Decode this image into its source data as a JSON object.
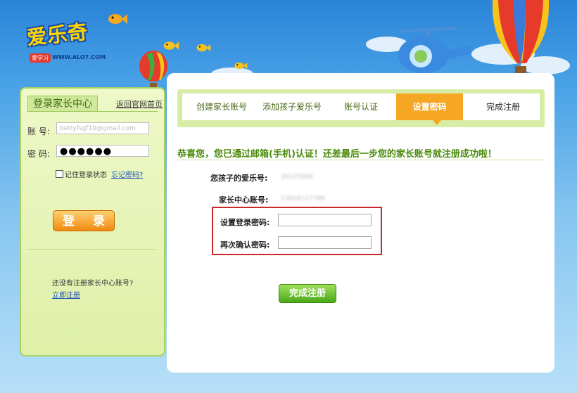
{
  "logo": {
    "name": "爱乐奇",
    "badge": "爱学习",
    "url": "WWW.ALO7.COM"
  },
  "sidebar": {
    "tab_title": "登录家长中心",
    "back_link": "返回官网首页",
    "account_label": "账 号:",
    "account_value": "bettyfsgf10@gmail.com",
    "password_label": "密 码:",
    "password_value": "●●●●●●",
    "remember_label": "记住登录状态",
    "forgot_link": "忘记密码?",
    "login_button": "登 录",
    "no_account_text": "还没有注册家长中心账号?",
    "register_link": "立即注册"
  },
  "steps": [
    {
      "label": "创建家长账号",
      "active": false
    },
    {
      "label": "添加孩子爱乐号",
      "active": false
    },
    {
      "label": "账号认证",
      "active": false
    },
    {
      "label": "设置密码",
      "active": true
    },
    {
      "label": "完成注册",
      "active": false
    }
  ],
  "main": {
    "congrats": "恭喜您，您已通过邮箱(手机)认证！还差最后一步您的家长账号就注册成功啦！",
    "child_id_label": "您孩子的爱乐号:",
    "child_id_value": "20133096",
    "parent_account_label": "家长中心账号:",
    "parent_account_value": "13916117786",
    "set_password_label": "设置登录密码:",
    "confirm_password_label": "再次确认密码:",
    "finish_button": "完成注册"
  },
  "colors": {
    "accent_orange": "#f5a623",
    "accent_green": "#4aa818",
    "highlight_red": "#c8282e"
  }
}
